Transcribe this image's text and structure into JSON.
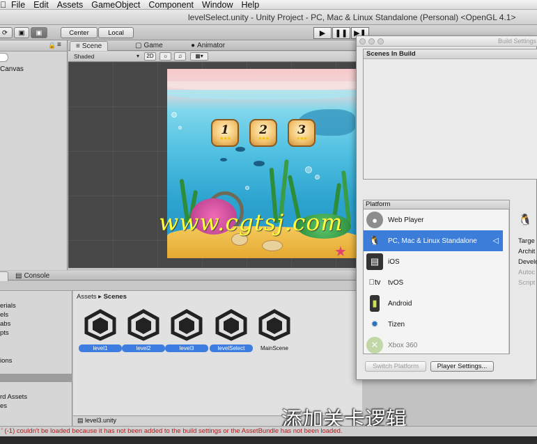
{
  "menubar": {
    "items": [
      "File",
      "Edit",
      "Assets",
      "GameObject",
      "Component",
      "Window",
      "Help"
    ]
  },
  "titlebar": {
    "title": "levelSelect.unity - Unity Project - PC, Mac & Linux Standalone (Personal) <OpenGL 4.1>"
  },
  "toolbar": {
    "center": "Center",
    "local": "Local"
  },
  "hierarchy": {
    "item": "Canvas"
  },
  "scene": {
    "tabs": [
      "Scene",
      "Game",
      "Animator"
    ],
    "shading": "Shaded",
    "mode_2d": "2D",
    "levels": [
      "1",
      "2",
      "3"
    ]
  },
  "watermark": "www.cgtsj.com",
  "bottom": {
    "tab_console": "Console",
    "left_items": [
      "erials",
      "els",
      "abs",
      "pts",
      "ions",
      "rd Assets",
      "es"
    ],
    "breadcrumb_root": "Assets",
    "breadcrumb_current": "Scenes",
    "assets": [
      "level1",
      "level2",
      "level3",
      "levelSelect",
      "MainScene"
    ],
    "path": "level3.unity"
  },
  "subtitle": "添加关卡逻辑",
  "status": "' (-1) couldn't be loaded because it has not been added to the build settings or the AssetBundle has not been loaded.",
  "build_settings": {
    "title": "Build Settings",
    "scenes_in_build": "Scenes In Build",
    "platform_header": "Platform",
    "platforms": [
      "Web Player",
      "PC, Mac & Linux Standalone",
      "iOS",
      "tvOS",
      "Android",
      "Tizen",
      "Xbox 360"
    ],
    "selected_platform": "PC, Mac & Linux Standalone",
    "switch_platform": "Switch Platform",
    "player_settings": "Player Settings...",
    "right_labels": [
      "Targe",
      "Archit",
      "Develo",
      "Autoc",
      "Script"
    ]
  }
}
